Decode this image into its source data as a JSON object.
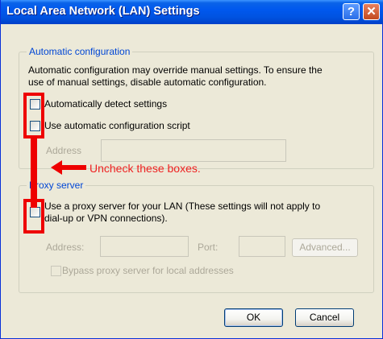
{
  "window": {
    "title": "Local Area Network (LAN) Settings",
    "help_glyph": "?",
    "close_glyph": "✕"
  },
  "auto_config": {
    "legend": "Automatic configuration",
    "description_line1": "Automatic configuration may override manual settings.  To ensure the",
    "description_line2": "use of manual settings, disable automatic configuration.",
    "detect_label": "Automatically detect settings",
    "detect_checked": false,
    "script_label": "Use automatic configuration script",
    "script_checked": false,
    "address_label": "Address",
    "address_value": ""
  },
  "proxy": {
    "legend": "Proxy server",
    "use_proxy_line1": "Use a proxy server for your LAN (These settings will not apply to",
    "use_proxy_line2": "dial-up or VPN connections).",
    "use_proxy_checked": false,
    "address_label": "Address:",
    "address_value": "",
    "port_label": "Port:",
    "port_value": "",
    "advanced_label": "Advanced...",
    "bypass_label": "Bypass proxy server for local addresses",
    "bypass_checked": false
  },
  "buttons": {
    "ok": "OK",
    "cancel": "Cancel"
  },
  "annotation": {
    "text": "Uncheck these boxes.",
    "color": "#ee0000"
  }
}
